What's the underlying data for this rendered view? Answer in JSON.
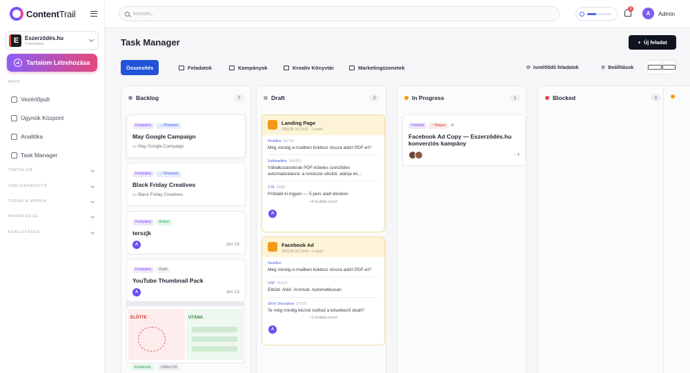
{
  "app": {
    "brand_bold": "Content",
    "brand_light": "Trail"
  },
  "workspace": {
    "name": "Eszerződés.hu",
    "sub": "2 members",
    "initial": "E"
  },
  "sidebar": {
    "create_label": "Tartalom Létrehozása",
    "main_label": "MAIN",
    "items": [
      {
        "label": "Vezérlőpult",
        "icon": "home-icon"
      },
      {
        "label": "Ügynök Központ",
        "icon": "robot-icon"
      },
      {
        "label": "Analitika",
        "icon": "chart-icon"
      },
      {
        "label": "Task Manager",
        "icon": "checkbox-icon"
      }
    ],
    "groups": [
      "TARTALOM",
      "SABLONKÉSZÍTŐ",
      "TUDÁS & MÁRKA",
      "WORKFORCE",
      "BEÁLLÍTÁSOK"
    ]
  },
  "topbar": {
    "search_placeholder": "Keresés...",
    "quota_fraction": 0.35,
    "notifications": "2",
    "user_initial": "A",
    "user_name": "Admin"
  },
  "page": {
    "title": "Task Manager",
    "new_task_label": "Új feladat"
  },
  "tabs": [
    {
      "label": "Összesítés",
      "active": true
    },
    {
      "label": "Feladatok",
      "active": false
    },
    {
      "label": "Kampányok",
      "active": false
    },
    {
      "label": "Kreatív Könyvtár",
      "active": false
    },
    {
      "label": "Marketingüzenetek",
      "active": false
    }
  ],
  "right_tabs": [
    "Ismétlődő feladatok",
    "Beállítások"
  ],
  "columns": [
    {
      "name": "Backlog",
      "count": "7",
      "color": "#8c93a3"
    },
    {
      "name": "Draft",
      "count": "2",
      "color": "#a3a8b4"
    },
    {
      "name": "In Progress",
      "count": "1",
      "color": "#f59e0b"
    },
    {
      "name": "Blocked",
      "count": "0",
      "color": "#ef4444"
    }
  ],
  "backlog": [
    {
      "tags": [
        "Kampány",
        "→ Közepes"
      ],
      "title": "May Google Campaign",
      "sub": "May Google Campaign"
    },
    {
      "tags": [
        "Kampány",
        "→ Közepes"
      ],
      "title": "Black Friday Creatives",
      "sub": "Black Friday Creatives"
    },
    {
      "tags": [
        "Kampány",
        "Active"
      ],
      "title": "terszjk",
      "date": "Jun 15",
      "avatar": "A"
    },
    {
      "tags": [
        "Kampány",
        "Draft"
      ],
      "title": "YouTube Thumbnail Pack",
      "date": "Jun 13",
      "avatar": "A"
    },
    {
      "thumb_left": "ELŐTTE",
      "thumb_right": "UTÁNA",
      "tags": [
        "Kreatívok",
        "1280x720"
      ]
    }
  ],
  "drafts": [
    {
      "title": "Landing Page",
      "meta": "2026.06.15 19:01 · 1 mező",
      "fields": [
        {
          "tag": "Headline",
          "len": "52/120",
          "text": "Még mindig e-mailben küldesz vissza aláírt PDF-et?"
        },
        {
          "tag": "Subheadline",
          "len": "140/200",
          "text": "Vállalkozásoknak PDF-köteles szerződés automatizálásra: a rendszer elküldi, aláírja és..."
        },
        {
          "tag": "CTA",
          "len": "43/80",
          "text": "Próbáld ki ingyen — 5 perc alatt élesben"
        }
      ],
      "more": "+4 további mező",
      "avatar": "A"
    },
    {
      "title": "Facebook Ad",
      "meta": "2026.06.15 19:04 · 1 mező",
      "fields": [
        {
          "tag": "Headline",
          "len": "",
          "text": "Még mindig e-mailben küldesz vissza aláírt PDF-et?"
        },
        {
          "tag": "USP",
          "len": "45/120",
          "text": "Elküld. Aláír. Archivál. Automatikusan."
        },
        {
          "tag": "Short Description",
          "len": "37/160",
          "text": "Te még mindig kézzel indítod a következő dealt?"
        }
      ],
      "more": "+1 további mező",
      "avatar": "A"
    }
  ],
  "in_progress": [
    {
      "tags": [
        "Feladat",
        "↑ Magas"
      ],
      "title": "Facebook Ad Copy — Eszerződés.hu konverziós kampány",
      "comments": "4"
    }
  ],
  "colors": {
    "accent": "#2152d8",
    "brand_purple": "#7c4dff",
    "brand_pink": "#e5487c",
    "dark_button": "#0f1420"
  }
}
